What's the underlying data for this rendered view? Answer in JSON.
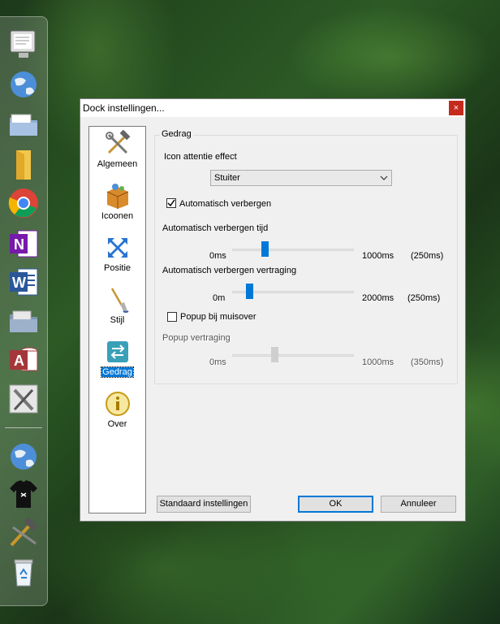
{
  "dialog": {
    "title": "Dock instellingen...",
    "close_glyph": "×"
  },
  "nav": {
    "items": [
      {
        "label": "Algemeen",
        "icon": "tools-icon"
      },
      {
        "label": "Icoonen",
        "icon": "box-icon"
      },
      {
        "label": "Positie",
        "icon": "move-arrows-icon"
      },
      {
        "label": "Stijl",
        "icon": "brush-icon"
      },
      {
        "label": "Gedrag",
        "icon": "swap-arrows-icon",
        "selected": true
      },
      {
        "label": "Over",
        "icon": "info-icon"
      }
    ]
  },
  "group": {
    "title": "Gedrag",
    "attention_label": "Icon attentie effect",
    "attention_value": "Stuiter",
    "autohide_label": "Automatisch verbergen",
    "autohide_checked": true,
    "hide_time": {
      "label": "Automatisch verbergen tijd",
      "min": "0ms",
      "max": "1000ms",
      "current": "(250ms)",
      "fraction": 0.25
    },
    "hide_delay": {
      "label": "Automatisch verbergen vertraging",
      "min": "0m",
      "max": "2000ms",
      "current": "(250ms)",
      "fraction": 0.125
    },
    "popup_label": "Popup bij muisover",
    "popup_checked": false,
    "popup_delay": {
      "label": "Popup vertraging",
      "min": "0ms",
      "max": "1000ms",
      "current": "(350ms)",
      "fraction": 0.35
    }
  },
  "buttons": {
    "defaults": "Standaard instellingen",
    "ok": "OK",
    "cancel": "Annuleer"
  },
  "dock_icons": [
    "computer-icon",
    "globe-icon",
    "folder-icon",
    "file-icon",
    "chrome-icon",
    "onenote-icon",
    "word-icon",
    "folder-icon",
    "access-icon",
    "tools-icon",
    "globe-icon",
    "tshirt-icon",
    "hammer-icon",
    "recycle-bin-icon"
  ]
}
